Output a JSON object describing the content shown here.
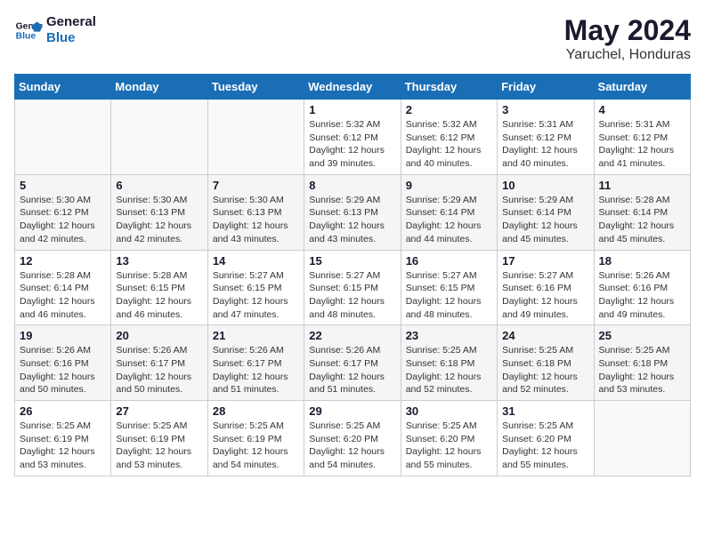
{
  "header": {
    "logo_line1": "General",
    "logo_line2": "Blue",
    "month_year": "May 2024",
    "location": "Yaruchel, Honduras"
  },
  "days_of_week": [
    "Sunday",
    "Monday",
    "Tuesday",
    "Wednesday",
    "Thursday",
    "Friday",
    "Saturday"
  ],
  "weeks": [
    [
      {
        "day": "",
        "info": ""
      },
      {
        "day": "",
        "info": ""
      },
      {
        "day": "",
        "info": ""
      },
      {
        "day": "1",
        "info": "Sunrise: 5:32 AM\nSunset: 6:12 PM\nDaylight: 12 hours\nand 39 minutes."
      },
      {
        "day": "2",
        "info": "Sunrise: 5:32 AM\nSunset: 6:12 PM\nDaylight: 12 hours\nand 40 minutes."
      },
      {
        "day": "3",
        "info": "Sunrise: 5:31 AM\nSunset: 6:12 PM\nDaylight: 12 hours\nand 40 minutes."
      },
      {
        "day": "4",
        "info": "Sunrise: 5:31 AM\nSunset: 6:12 PM\nDaylight: 12 hours\nand 41 minutes."
      }
    ],
    [
      {
        "day": "5",
        "info": "Sunrise: 5:30 AM\nSunset: 6:12 PM\nDaylight: 12 hours\nand 42 minutes."
      },
      {
        "day": "6",
        "info": "Sunrise: 5:30 AM\nSunset: 6:13 PM\nDaylight: 12 hours\nand 42 minutes."
      },
      {
        "day": "7",
        "info": "Sunrise: 5:30 AM\nSunset: 6:13 PM\nDaylight: 12 hours\nand 43 minutes."
      },
      {
        "day": "8",
        "info": "Sunrise: 5:29 AM\nSunset: 6:13 PM\nDaylight: 12 hours\nand 43 minutes."
      },
      {
        "day": "9",
        "info": "Sunrise: 5:29 AM\nSunset: 6:14 PM\nDaylight: 12 hours\nand 44 minutes."
      },
      {
        "day": "10",
        "info": "Sunrise: 5:29 AM\nSunset: 6:14 PM\nDaylight: 12 hours\nand 45 minutes."
      },
      {
        "day": "11",
        "info": "Sunrise: 5:28 AM\nSunset: 6:14 PM\nDaylight: 12 hours\nand 45 minutes."
      }
    ],
    [
      {
        "day": "12",
        "info": "Sunrise: 5:28 AM\nSunset: 6:14 PM\nDaylight: 12 hours\nand 46 minutes."
      },
      {
        "day": "13",
        "info": "Sunrise: 5:28 AM\nSunset: 6:15 PM\nDaylight: 12 hours\nand 46 minutes."
      },
      {
        "day": "14",
        "info": "Sunrise: 5:27 AM\nSunset: 6:15 PM\nDaylight: 12 hours\nand 47 minutes."
      },
      {
        "day": "15",
        "info": "Sunrise: 5:27 AM\nSunset: 6:15 PM\nDaylight: 12 hours\nand 48 minutes."
      },
      {
        "day": "16",
        "info": "Sunrise: 5:27 AM\nSunset: 6:15 PM\nDaylight: 12 hours\nand 48 minutes."
      },
      {
        "day": "17",
        "info": "Sunrise: 5:27 AM\nSunset: 6:16 PM\nDaylight: 12 hours\nand 49 minutes."
      },
      {
        "day": "18",
        "info": "Sunrise: 5:26 AM\nSunset: 6:16 PM\nDaylight: 12 hours\nand 49 minutes."
      }
    ],
    [
      {
        "day": "19",
        "info": "Sunrise: 5:26 AM\nSunset: 6:16 PM\nDaylight: 12 hours\nand 50 minutes."
      },
      {
        "day": "20",
        "info": "Sunrise: 5:26 AM\nSunset: 6:17 PM\nDaylight: 12 hours\nand 50 minutes."
      },
      {
        "day": "21",
        "info": "Sunrise: 5:26 AM\nSunset: 6:17 PM\nDaylight: 12 hours\nand 51 minutes."
      },
      {
        "day": "22",
        "info": "Sunrise: 5:26 AM\nSunset: 6:17 PM\nDaylight: 12 hours\nand 51 minutes."
      },
      {
        "day": "23",
        "info": "Sunrise: 5:25 AM\nSunset: 6:18 PM\nDaylight: 12 hours\nand 52 minutes."
      },
      {
        "day": "24",
        "info": "Sunrise: 5:25 AM\nSunset: 6:18 PM\nDaylight: 12 hours\nand 52 minutes."
      },
      {
        "day": "25",
        "info": "Sunrise: 5:25 AM\nSunset: 6:18 PM\nDaylight: 12 hours\nand 53 minutes."
      }
    ],
    [
      {
        "day": "26",
        "info": "Sunrise: 5:25 AM\nSunset: 6:19 PM\nDaylight: 12 hours\nand 53 minutes."
      },
      {
        "day": "27",
        "info": "Sunrise: 5:25 AM\nSunset: 6:19 PM\nDaylight: 12 hours\nand 53 minutes."
      },
      {
        "day": "28",
        "info": "Sunrise: 5:25 AM\nSunset: 6:19 PM\nDaylight: 12 hours\nand 54 minutes."
      },
      {
        "day": "29",
        "info": "Sunrise: 5:25 AM\nSunset: 6:20 PM\nDaylight: 12 hours\nand 54 minutes."
      },
      {
        "day": "30",
        "info": "Sunrise: 5:25 AM\nSunset: 6:20 PM\nDaylight: 12 hours\nand 55 minutes."
      },
      {
        "day": "31",
        "info": "Sunrise: 5:25 AM\nSunset: 6:20 PM\nDaylight: 12 hours\nand 55 minutes."
      },
      {
        "day": "",
        "info": ""
      }
    ]
  ]
}
